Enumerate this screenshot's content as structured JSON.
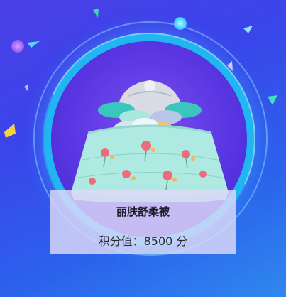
{
  "product": {
    "name": "丽肤舒柔被",
    "points_label": "积分值：8500 分"
  },
  "colors": {
    "background_start": "#4a3fe6",
    "background_end": "#2f88ee",
    "disc": "#5a36e2",
    "ring_glow": "#1fb6f2",
    "card_bg": "#dedaf8"
  },
  "icons": [
    "confetti-icon",
    "bedding-product-image"
  ]
}
